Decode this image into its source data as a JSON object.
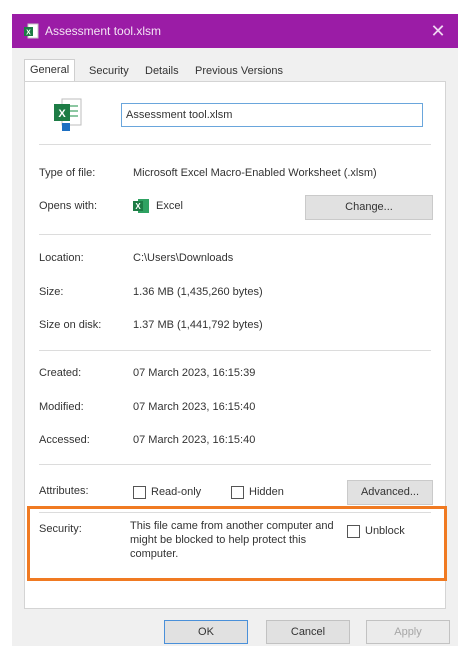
{
  "window": {
    "title": "Assessment tool.xlsm",
    "accent_color": "#9b1ca6",
    "close_glyph": "✕"
  },
  "tabs": [
    {
      "label": "General",
      "active": true
    },
    {
      "label": "Security",
      "active": false
    },
    {
      "label": "Details",
      "active": false
    },
    {
      "label": "Previous Versions",
      "active": false
    }
  ],
  "general": {
    "file_name": "Assessment tool.xlsm",
    "type_label": "Type of file:",
    "type_value": "Microsoft Excel Macro-Enabled Worksheet (.xlsm)",
    "opens_label": "Opens with:",
    "opens_value": "Excel",
    "change_button": "Change...",
    "location_label": "Location:",
    "location_value": "C:\\Users\\Downloads",
    "size_label": "Size:",
    "size_value": "1.36 MB (1,435,260 bytes)",
    "size_on_disk_label": "Size on disk:",
    "size_on_disk_value": "1.37 MB (1,441,792 bytes)",
    "created_label": "Created:",
    "created_value": "07 March 2023, 16:15:39",
    "modified_label": "Modified:",
    "modified_value": "07 March 2023, 16:15:40",
    "accessed_label": "Accessed:",
    "accessed_value": "07 March 2023, 16:15:40",
    "attributes_label": "Attributes:",
    "readonly_label": "Read-only",
    "hidden_label": "Hidden",
    "advanced_button": "Advanced...",
    "security_label": "Security:",
    "security_text": "This file came from another computer and might be blocked to help protect this computer.",
    "unblock_label": "Unblock",
    "highlight_color": "#f07a22"
  },
  "footer": {
    "ok": "OK",
    "cancel": "Cancel",
    "apply": "Apply"
  }
}
